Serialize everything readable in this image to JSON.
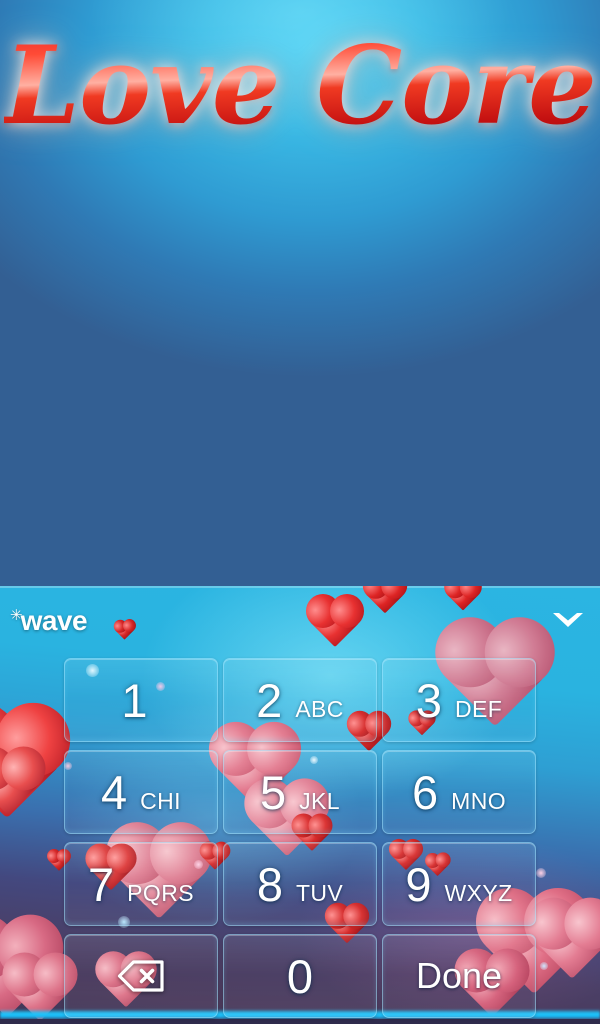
{
  "theme": {
    "name": "Love Core",
    "accent_red": "#e8272a",
    "accent_cyan": "#2bb5e2",
    "key_text_color": "#ffffff"
  },
  "wallpaper": {
    "title": "Love Core"
  },
  "keyboard": {
    "brand": {
      "star": "✳",
      "label": "wave"
    },
    "collapse_icon": "chevron-down-icon",
    "rows": [
      [
        {
          "name": "key-1",
          "num": "1",
          "letters": "",
          "type": "digit"
        },
        {
          "name": "key-2",
          "num": "2",
          "letters": "ABC",
          "type": "digit"
        },
        {
          "name": "key-3",
          "num": "3",
          "letters": "DEF",
          "type": "digit"
        }
      ],
      [
        {
          "name": "key-4",
          "num": "4",
          "letters": "CHI",
          "type": "digit"
        },
        {
          "name": "key-5",
          "num": "5",
          "letters": "JKL",
          "type": "digit"
        },
        {
          "name": "key-6",
          "num": "6",
          "letters": "MNO",
          "type": "digit"
        }
      ],
      [
        {
          "name": "key-7",
          "num": "7",
          "letters": "PQRS",
          "type": "digit"
        },
        {
          "name": "key-8",
          "num": "8",
          "letters": "TUV",
          "type": "digit"
        },
        {
          "name": "key-9",
          "num": "9",
          "letters": "WXYZ",
          "type": "digit"
        }
      ],
      [
        {
          "name": "key-backspace",
          "num": "",
          "letters": "",
          "type": "backspace",
          "icon": "backspace-icon"
        },
        {
          "name": "key-0",
          "num": "0",
          "letters": "",
          "type": "digit"
        },
        {
          "name": "key-done",
          "num": "",
          "letters": "",
          "type": "action",
          "label": "Done"
        }
      ]
    ]
  }
}
